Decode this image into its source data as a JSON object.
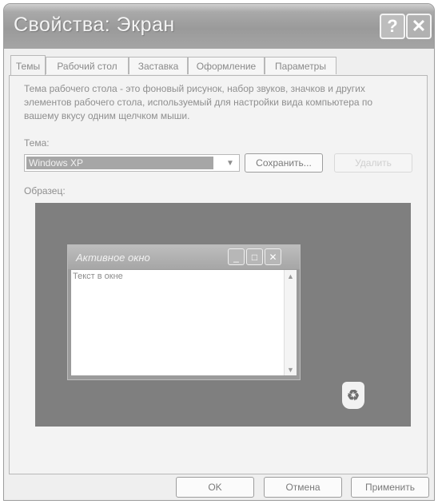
{
  "window": {
    "title": "Свойства: Экран"
  },
  "titlebar": {
    "help_label": "?",
    "close_label": "✕"
  },
  "tabs": [
    {
      "label": "Темы",
      "active": true
    },
    {
      "label": "Рабочий стол"
    },
    {
      "label": "Заставка"
    },
    {
      "label": "Оформление"
    },
    {
      "label": "Параметры"
    }
  ],
  "themes_page": {
    "description": "Тема рабочего стола - это фоновый рисунок, набор звуков, значков и других элементов рабочего стола, используемый для настройки вида компьютера по вашему вкусу одним щелчком мыши.",
    "theme_label": "Тема:",
    "theme_value": "Windows XP",
    "save_button": "Сохранить...",
    "delete_button": "Удалить",
    "sample_label": "Образец:",
    "preview": {
      "window_title": "Активное окно",
      "window_text": "Текст в окне"
    }
  },
  "footer": {
    "ok": "OK",
    "cancel": "Отмена",
    "apply": "Применить"
  }
}
